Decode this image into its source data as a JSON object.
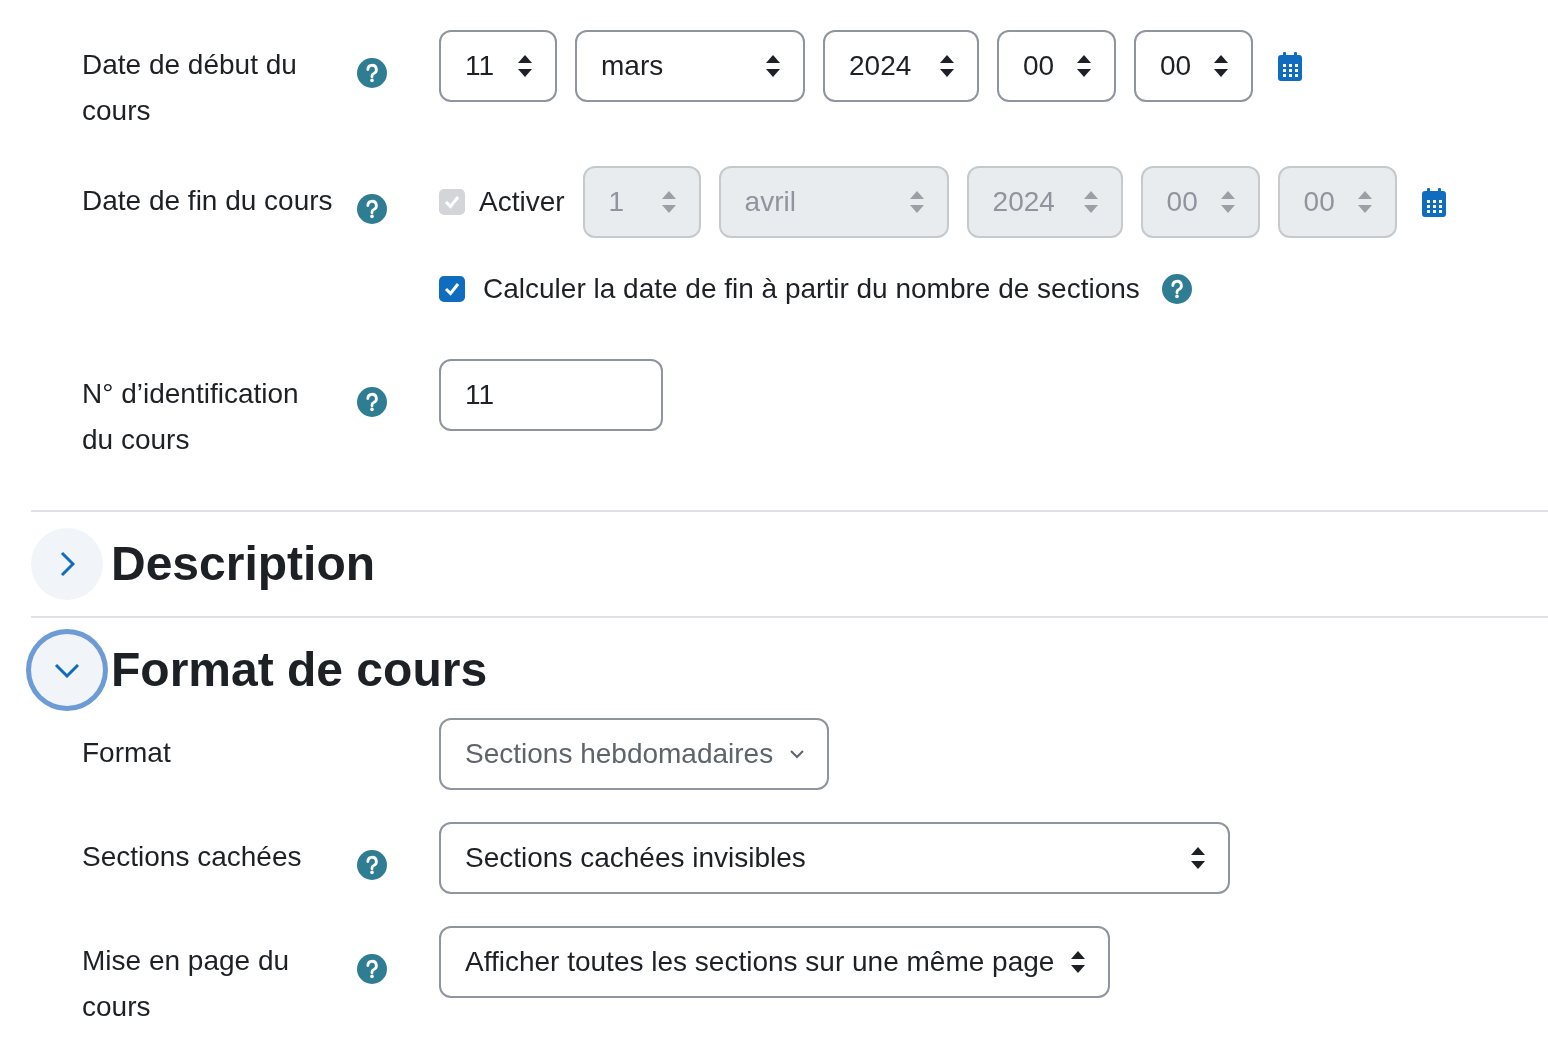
{
  "general_rows": [
    {
      "kind": "date",
      "label": "Date de début du cours",
      "help": true,
      "disabled": false,
      "parts": [
        "11",
        "mars",
        "2024",
        "00",
        "00"
      ]
    },
    {
      "kind": "date",
      "label": "Date de fin du cours",
      "help": true,
      "disabled": true,
      "enable": {
        "label": "Activer",
        "checked": true,
        "disabled": true
      },
      "parts": [
        "1",
        "avril",
        "2024",
        "00",
        "00"
      ]
    },
    {
      "kind": "checkbox",
      "label": "Calculer la date de fin à partir du nombre de sections",
      "checked": true,
      "help": true
    },
    {
      "kind": "text",
      "label": "N° d’identification du cours",
      "help": true,
      "value": "11"
    }
  ],
  "sections": [
    {
      "title": "Description",
      "expanded": false,
      "focused": false
    },
    {
      "title": "Format de cours",
      "expanded": true,
      "focused": true,
      "rows": [
        {
          "kind": "combo",
          "label": "Format",
          "help": false,
          "value": "Sections hebdomadaires"
        },
        {
          "kind": "select",
          "label": "Sections cachées",
          "help": true,
          "value": "Sections cachées invisibles"
        },
        {
          "kind": "select",
          "label": "Mise en page du cours",
          "help": true,
          "value": "Afficher toutes les sections sur une même page"
        }
      ]
    }
  ]
}
